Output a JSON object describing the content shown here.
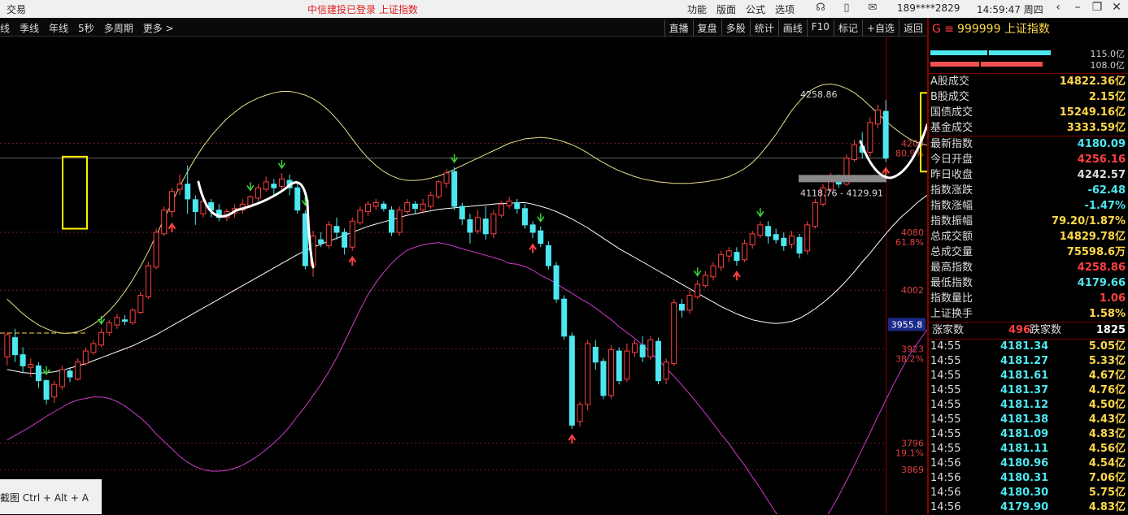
{
  "window": {
    "app_name": "交易",
    "center_status": "中信建投已登录  上证指数",
    "menu": [
      "功能",
      "版面",
      "公式",
      "选项"
    ],
    "phone": "189****2829",
    "clock": "14:59:47 周四"
  },
  "toolbar": {
    "periods": [
      "线",
      "季线",
      "年线",
      "5秒",
      "多周期",
      "更多 >"
    ],
    "tools": [
      "直播",
      "复盘",
      "多股",
      "统计",
      "画线",
      "F10",
      "标记",
      "+自选",
      "返回"
    ]
  },
  "chart": {
    "y_labels": [
      {
        "v": "4200",
        "p": "80.9%",
        "price": 4200
      },
      {
        "v": "4080",
        "p": "61.8%",
        "price": 4080
      },
      {
        "v": "4002",
        "p": "",
        "price": 4002
      },
      {
        "v": "3923",
        "p": "38.2%",
        "price": 3923
      },
      {
        "v": "3796",
        "p": "19.1%",
        "price": 3796
      },
      {
        "v": "3869",
        "p": "",
        "price": 3760
      }
    ],
    "current_price": "3955.8",
    "current_price_value": 3955.8,
    "high_label": "4258.86",
    "range_label": "4118.76 - 4129.91",
    "colors": {
      "up": "#ff4040",
      "down": "#4de7f0",
      "boll_mid": "#ffffff",
      "boll_up": "#e8e08a",
      "boll_low": "#d03ad0",
      "box": "#ffee00",
      "annot": "#ffffff"
    },
    "candles": [
      [
        3912,
        3942,
        3900,
        3945
      ],
      [
        3938,
        3915,
        3905,
        3950
      ],
      [
        3915,
        3900,
        3890,
        3925
      ],
      [
        3898,
        3902,
        3885,
        3910
      ],
      [
        3900,
        3880,
        3870,
        3905
      ],
      [
        3880,
        3855,
        3848,
        3882
      ],
      [
        3858,
        3875,
        3850,
        3880
      ],
      [
        3872,
        3895,
        3868,
        3900
      ],
      [
        3893,
        3885,
        3878,
        3898
      ],
      [
        3882,
        3905,
        3880,
        3910
      ],
      [
        3903,
        3920,
        3900,
        3925
      ],
      [
        3918,
        3930,
        3915,
        3935
      ],
      [
        3928,
        3945,
        3925,
        3950
      ],
      [
        3945,
        3958,
        3940,
        3962
      ],
      [
        3955,
        3965,
        3950,
        3970
      ],
      [
        3962,
        3960,
        3955,
        3968
      ],
      [
        3958,
        3975,
        3955,
        3978
      ],
      [
        3972,
        3995,
        3970,
        4000
      ],
      [
        3993,
        4035,
        3990,
        4040
      ],
      [
        4033,
        4080,
        4030,
        4085
      ],
      [
        4078,
        4110,
        4075,
        4115
      ],
      [
        4108,
        4135,
        4100,
        4140
      ],
      [
        4138,
        4145,
        4130,
        4158
      ],
      [
        4145,
        4125,
        4105,
        4170
      ],
      [
        4124,
        4108,
        4090,
        4130
      ],
      [
        4105,
        4122,
        4100,
        4130
      ],
      [
        4120,
        4110,
        4100,
        4125
      ],
      [
        4110,
        4100,
        4095,
        4118
      ],
      [
        4100,
        4108,
        4095,
        4112
      ],
      [
        4106,
        4112,
        4100,
        4118
      ],
      [
        4110,
        4118,
        4105,
        4125
      ],
      [
        4116,
        4128,
        4112,
        4130
      ],
      [
        4126,
        4140,
        4122,
        4145
      ],
      [
        4138,
        4148,
        4135,
        4155
      ],
      [
        4145,
        4140,
        4130,
        4152
      ],
      [
        4142,
        4152,
        4138,
        4160
      ],
      [
        4150,
        4140,
        4130,
        4158
      ],
      [
        4140,
        4110,
        4105,
        4148
      ],
      [
        4105,
        4035,
        4030,
        4110
      ],
      [
        4035,
        4075,
        4020,
        4082
      ],
      [
        4070,
        4065,
        4060,
        4080
      ],
      [
        4062,
        4090,
        4058,
        4095
      ],
      [
        4088,
        4080,
        4070,
        4100
      ],
      [
        4080,
        4060,
        4050,
        4085
      ],
      [
        4060,
        4095,
        4055,
        4100
      ],
      [
        4093,
        4110,
        4090,
        4115
      ],
      [
        4108,
        4118,
        4102,
        4122
      ],
      [
        4115,
        4120,
        4110,
        4125
      ],
      [
        4118,
        4112,
        4108,
        4122
      ],
      [
        4110,
        4080,
        4075,
        4115
      ],
      [
        4080,
        4110,
        4075,
        4115
      ],
      [
        4108,
        4120,
        4105,
        4125
      ],
      [
        4118,
        4112,
        4105,
        4122
      ],
      [
        4110,
        4118,
        4105,
        4125
      ],
      [
        4115,
        4130,
        4112,
        4135
      ],
      [
        4128,
        4148,
        4125,
        4150
      ],
      [
        4146,
        4160,
        4140,
        4165
      ],
      [
        4162,
        4115,
        4110,
        4168
      ],
      [
        4115,
        4098,
        4090,
        4120
      ],
      [
        4097,
        4080,
        4065,
        4105
      ],
      [
        4082,
        4100,
        4078,
        4110
      ],
      [
        4098,
        4078,
        4070,
        4115
      ],
      [
        4078,
        4105,
        4072,
        4110
      ],
      [
        4103,
        4118,
        4100,
        4122
      ],
      [
        4116,
        4122,
        4112,
        4128
      ],
      [
        4120,
        4112,
        4105,
        4125
      ],
      [
        4112,
        4090,
        4085,
        4118
      ],
      [
        4090,
        4080,
        4072,
        4095
      ],
      [
        4082,
        4065,
        4060,
        4088
      ],
      [
        4062,
        4035,
        4030,
        4068
      ],
      [
        4035,
        3990,
        3985,
        4040
      ],
      [
        3990,
        3940,
        3935,
        3995
      ],
      [
        3940,
        3820,
        3815,
        3945
      ],
      [
        3825,
        3848,
        3818,
        3852
      ],
      [
        3848,
        3930,
        3840,
        3935
      ],
      [
        3925,
        3905,
        3895,
        3935
      ],
      [
        3906,
        3860,
        3855,
        3910
      ],
      [
        3860,
        3922,
        3855,
        3928
      ],
      [
        3920,
        3880,
        3875,
        3925
      ],
      [
        3882,
        3920,
        3878,
        3930
      ],
      [
        3918,
        3930,
        3912,
        3935
      ],
      [
        3928,
        3912,
        3905,
        3940
      ],
      [
        3912,
        3935,
        3908,
        3940
      ],
      [
        3933,
        3880,
        3875,
        3938
      ],
      [
        3882,
        3905,
        3875,
        3910
      ],
      [
        3903,
        3985,
        3900,
        3990
      ],
      [
        3983,
        3975,
        3965,
        3990
      ],
      [
        3975,
        3995,
        3970,
        4002
      ],
      [
        3993,
        4010,
        3990,
        4015
      ],
      [
        4008,
        4022,
        4005,
        4028
      ],
      [
        4020,
        4035,
        4015,
        4040
      ],
      [
        4033,
        4050,
        4028,
        4055
      ],
      [
        4048,
        4055,
        4040,
        4060
      ],
      [
        4053,
        4042,
        4035,
        4060
      ],
      [
        4043,
        4065,
        4040,
        4070
      ],
      [
        4063,
        4078,
        4058,
        4082
      ],
      [
        4076,
        4090,
        4072,
        4095
      ],
      [
        4088,
        4075,
        4065,
        4095
      ],
      [
        4077,
        4070,
        4065,
        4085
      ],
      [
        4072,
        4062,
        4055,
        4080
      ],
      [
        4064,
        4075,
        4058,
        4082
      ],
      [
        4073,
        4052,
        4045,
        4078
      ],
      [
        4055,
        4090,
        4050,
        4095
      ],
      [
        4088,
        4120,
        4085,
        4125
      ],
      [
        4118,
        4140,
        4115,
        4145
      ],
      [
        4138,
        4155,
        4135,
        4160
      ],
      [
        4152,
        4145,
        4140,
        4158
      ],
      [
        4145,
        4180,
        4142,
        4185
      ],
      [
        4178,
        4198,
        4175,
        4205
      ],
      [
        4196,
        4188,
        4180,
        4215
      ],
      [
        4188,
        4228,
        4182,
        4235
      ],
      [
        4226,
        4245,
        4220,
        4252
      ],
      [
        4243,
        4180,
        4175,
        4258
      ]
    ],
    "boll_mid": [
      3895,
      3893,
      3891,
      3890,
      3890,
      3891,
      3892,
      3894,
      3897,
      3900,
      3903,
      3907,
      3911,
      3915,
      3919,
      3923,
      3927,
      3932,
      3937,
      3942,
      3948,
      3954,
      3960,
      3966,
      3972,
      3978,
      3984,
      3990,
      3996,
      4002,
      4008,
      4014,
      4020,
      4026,
      4032,
      4038,
      4044,
      4050,
      4055,
      4060,
      4064,
      4068,
      4072,
      4076,
      4080,
      4084,
      4088,
      4091,
      4094,
      4097,
      4100,
      4103,
      4105,
      4107,
      4109,
      4111,
      4112,
      4113,
      4114,
      4115,
      4116,
      4117,
      4118,
      4119,
      4119,
      4120,
      4120,
      4118,
      4115,
      4112,
      4108,
      4103,
      4098,
      4092,
      4086,
      4079,
      4072,
      4065,
      4058,
      4052,
      4046,
      4040,
      4034,
      4028,
      4022,
      4016,
      4010,
      4004,
      3998,
      3992,
      3986,
      3980,
      3975,
      3970,
      3966,
      3962,
      3960,
      3958,
      3957,
      3958,
      3960,
      3964,
      3970,
      3977,
      3985,
      3994,
      4004,
      4015,
      4027,
      4040,
      4052,
      4065,
      4078,
      4090,
      4101,
      4110,
      4120,
      4128,
      4135
    ],
    "boll_up": [
      3990,
      3980,
      3970,
      3962,
      3955,
      3950,
      3946,
      3944,
      3944,
      3946,
      3950,
      3956,
      3964,
      3974,
      3986,
      4000,
      4016,
      4034,
      4054,
      4076,
      4098,
      4120,
      4142,
      4162,
      4180,
      4196,
      4210,
      4222,
      4233,
      4242,
      4250,
      4256,
      4261,
      4265,
      4268,
      4270,
      4270,
      4268,
      4265,
      4260,
      4253,
      4244,
      4233,
      4220,
      4206,
      4192,
      4180,
      4170,
      4162,
      4156,
      4152,
      4150,
      4150,
      4151,
      4153,
      4156,
      4160,
      4165,
      4170,
      4175,
      4180,
      4185,
      4190,
      4195,
      4200,
      4203,
      4206,
      4207,
      4208,
      4207,
      4205,
      4202,
      4198,
      4193,
      4187,
      4180,
      4174,
      4168,
      4163,
      4159,
      4155,
      4152,
      4150,
      4148,
      4147,
      4146,
      4146,
      4146,
      4147,
      4148,
      4150,
      4152,
      4155,
      4160,
      4166,
      4174,
      4185,
      4198,
      4212,
      4228,
      4244,
      4257,
      4268,
      4275,
      4279,
      4280,
      4278,
      4274,
      4268,
      4260,
      4250,
      4240,
      4230,
      4221,
      4213,
      4206,
      4201,
      4198,
      4196
    ],
    "boll_low": [
      3800,
      3806,
      3812,
      3818,
      3825,
      3832,
      3838,
      3844,
      3850,
      3854,
      3856,
      3858,
      3858,
      3856,
      3852,
      3846,
      3838,
      3830,
      3820,
      3808,
      3798,
      3788,
      3778,
      3770,
      3764,
      3760,
      3758,
      3758,
      3759,
      3762,
      3766,
      3772,
      3779,
      3787,
      3796,
      3806,
      3818,
      3832,
      3845,
      3860,
      3875,
      3892,
      3911,
      3932,
      3954,
      3976,
      3996,
      4012,
      4026,
      4038,
      4048,
      4056,
      4060,
      4063,
      4065,
      4066,
      4064,
      4061,
      4058,
      4055,
      4052,
      4049,
      4046,
      4043,
      4038,
      4037,
      4034,
      4029,
      4022,
      4017,
      4011,
      4004,
      3998,
      3991,
      3985,
      3978,
      3970,
      3962,
      3953,
      3945,
      3937,
      3928,
      3918,
      3908,
      3897,
      3886,
      3874,
      3862,
      3849,
      3836,
      3822,
      3808,
      3795,
      3780,
      3766,
      3750,
      3735,
      3718,
      3702,
      3688,
      3676,
      3671,
      3672,
      3679,
      3690,
      3706,
      3725,
      3745,
      3766,
      3788,
      3810,
      3832,
      3854,
      3875,
      3895,
      3914,
      3930,
      3945,
      3958
    ],
    "boxes": [
      {
        "from": 36,
        "to": 46
      },
      {
        "from": 1050,
        "to": 1063
      }
    ],
    "arrows": [
      {
        "i": 5,
        "d": "down"
      },
      {
        "i": 12,
        "d": "down"
      },
      {
        "i": 21,
        "d": "up"
      },
      {
        "i": 31,
        "d": "down"
      },
      {
        "i": 35,
        "d": "down"
      },
      {
        "i": 38,
        "d": "down"
      },
      {
        "i": 44,
        "d": "up"
      },
      {
        "i": 57,
        "d": "down"
      },
      {
        "i": 67,
        "d": "up"
      },
      {
        "i": 68,
        "d": "down"
      },
      {
        "i": 72,
        "d": "up"
      },
      {
        "i": 88,
        "d": "down"
      },
      {
        "i": 93,
        "d": "up"
      },
      {
        "i": 96,
        "d": "down"
      },
      {
        "i": 112,
        "d": "up"
      },
      {
        "i": 115,
        "d": "down"
      },
      {
        "i": 118,
        "d": "down"
      }
    ]
  },
  "panel": {
    "code": "999999",
    "name": "上证指数",
    "bar1": "115.0亿",
    "bar2": "108.0亿",
    "rows1": [
      {
        "k": "A股成交",
        "v": "14822.36亿",
        "c": "#ffd84a"
      },
      {
        "k": "B股成交",
        "v": "2.15亿",
        "c": "#ffd84a"
      },
      {
        "k": "国债成交",
        "v": "15249.16亿",
        "c": "#ffd84a"
      },
      {
        "k": "基金成交",
        "v": "3333.59亿",
        "c": "#ffd84a"
      }
    ],
    "rows2": [
      {
        "k": "最新指数",
        "v": "4180.09",
        "c": "#4de7f0"
      },
      {
        "k": "今日开盘",
        "v": "4256.16",
        "c": "#ff4040"
      },
      {
        "k": "昨日收盘",
        "v": "4242.57",
        "c": "#dddddd"
      },
      {
        "k": "指数涨跌",
        "v": "-62.48",
        "c": "#4de7f0"
      },
      {
        "k": "指数涨幅",
        "v": "-1.47%",
        "c": "#4de7f0"
      },
      {
        "k": "指数振幅",
        "v": "79.20/1.87%",
        "c": "#ffd84a"
      },
      {
        "k": "总成交额",
        "v": "14829.78亿",
        "c": "#ffd84a"
      },
      {
        "k": "总成交量",
        "v": "75598.6万",
        "c": "#ffd84a"
      },
      {
        "k": "最高指数",
        "v": "4258.86",
        "c": "#ff4040"
      },
      {
        "k": "最低指数",
        "v": "4179.66",
        "c": "#4de7f0"
      },
      {
        "k": "指数量比",
        "v": "1.06",
        "c": "#ff4040"
      },
      {
        "k": "上证换手",
        "v": "1.58%",
        "c": "#ffd84a"
      }
    ],
    "up_label": "涨家数",
    "up_count": "496",
    "down_label": "跌家数",
    "down_count": "1825",
    "ticks": [
      [
        "14:55",
        "4181.34",
        "5.05亿"
      ],
      [
        "14:55",
        "4181.27",
        "5.33亿"
      ],
      [
        "14:55",
        "4181.61",
        "4.67亿"
      ],
      [
        "14:55",
        "4181.37",
        "4.76亿"
      ],
      [
        "14:55",
        "4181.12",
        "4.50亿"
      ],
      [
        "14:55",
        "4181.38",
        "4.43亿"
      ],
      [
        "14:55",
        "4181.09",
        "4.83亿"
      ],
      [
        "14:55",
        "4181.11",
        "4.56亿"
      ],
      [
        "14:56",
        "4180.96",
        "4.54亿"
      ],
      [
        "14:56",
        "4180.31",
        "7.06亿"
      ],
      [
        "14:56",
        "4180.30",
        "5.75亿"
      ],
      [
        "14:56",
        "4179.90",
        "4.83亿"
      ]
    ]
  },
  "hint": "截图 Ctrl + Alt + A"
}
